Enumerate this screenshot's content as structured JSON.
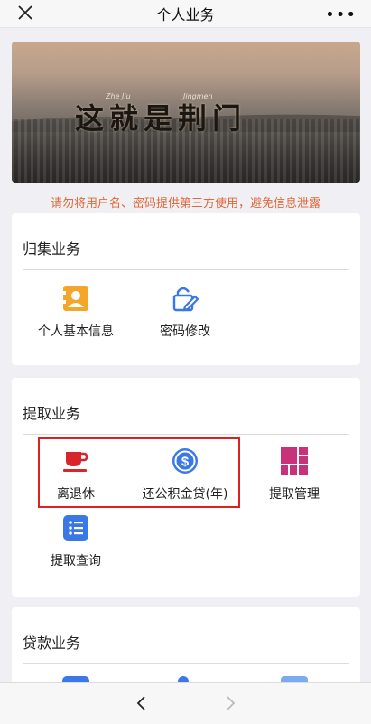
{
  "nav": {
    "title": "个人业务",
    "close_icon": "close-icon",
    "more_icon": "more-icon"
  },
  "banner": {
    "calligraphy": "这就是荆门",
    "pinyin_left": "Zhe Jiu",
    "pinyin_right": "Jingmen"
  },
  "warning": {
    "text": "请勿将用户名、密码提供第三方使用，避免信息泄露",
    "color": "#e0693a"
  },
  "sections": {
    "collection": {
      "title": "归集业务",
      "items": [
        {
          "label": "个人基本信息",
          "icon": "profile-card-icon",
          "color": "#f4a62a"
        },
        {
          "label": "密码修改",
          "icon": "edit-lock-icon",
          "color": "#3a78e7"
        }
      ]
    },
    "withdraw": {
      "title": "提取业务",
      "items": [
        {
          "label": "离退休",
          "icon": "coffee-cup-icon",
          "color": "#d8242a"
        },
        {
          "label": "还公积金贷(年)",
          "icon": "dollar-coin-icon",
          "color": "#3a78e7"
        },
        {
          "label": "提取管理",
          "icon": "grid-icon",
          "color": "#c8327a"
        },
        {
          "label": "提取查询",
          "icon": "list-icon",
          "color": "#3a78e7"
        }
      ]
    },
    "loan": {
      "title": "贷款业务"
    }
  },
  "bottom": {
    "back_icon": "back-arrow-icon",
    "forward_icon": "forward-arrow-icon"
  }
}
